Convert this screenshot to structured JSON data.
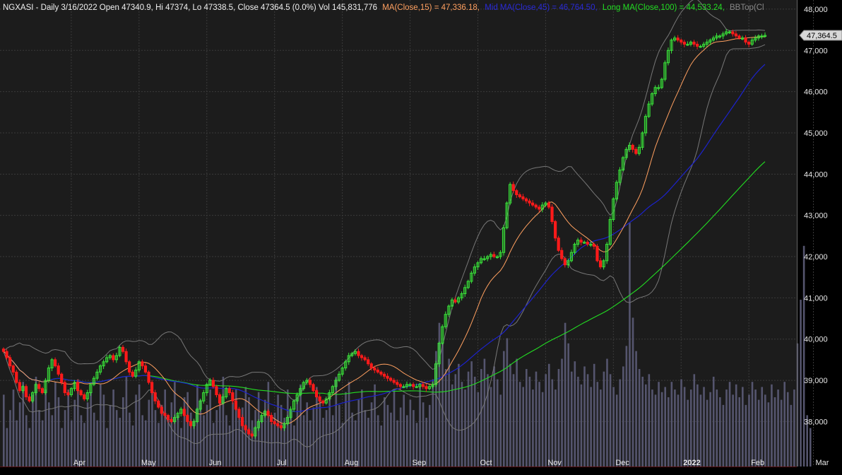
{
  "header": {
    "symbol_text": "NGXASI - Daily 3/16/2022 Open 47340.9, Hi 47374, Lo 47338.5, Close 47364.5 (0.0%) Vol 145,831,776",
    "ma15_text": "MA(Close,15) = 47,336.18,",
    "mid_ma_text": "Mid MA(Close,45) = 46,764.50,",
    "long_ma_text": "Long MA(Close,100) = 44,533.24,",
    "bb_text": "BBTop(Cl"
  },
  "price_label": "47,364.5",
  "colors": {
    "background": "#000000",
    "plot_bg": "#1c1c1c",
    "grid": "#3a3a3a",
    "up": "#39e639",
    "down": "#ff1a1a",
    "ma15": "#ffa060",
    "ma45": "#1c22cc",
    "ma100": "#22dd22",
    "bb": "#777777",
    "volume": "#55556e"
  },
  "chart_data": {
    "type": "candlestick",
    "title": "NGXASI - Daily",
    "ylim": [
      37400,
      48000
    ],
    "y_ticks": [
      38000,
      39000,
      40000,
      41000,
      42000,
      43000,
      44000,
      45000,
      46000,
      47000,
      48000
    ],
    "y_tick_labels": [
      "38,000",
      "39,000",
      "40,000",
      "41,000",
      "42,000",
      "43,000",
      "44,000",
      "45,000",
      "46,000",
      "47,000",
      "48,000"
    ],
    "x_tick_labels": [
      {
        "label": "Apr",
        "bar": 21
      },
      {
        "label": "May",
        "bar": 42
      },
      {
        "label": "Jun",
        "bar": 63
      },
      {
        "label": "Jul",
        "bar": 84
      },
      {
        "label": "Aug",
        "bar": 105
      },
      {
        "label": "Sep",
        "bar": 126
      },
      {
        "label": "Oct",
        "bar": 147
      },
      {
        "label": "Nov",
        "bar": 168
      },
      {
        "label": "Dec",
        "bar": 189
      },
      {
        "label": "2022",
        "bar": 210
      },
      {
        "label": "Feb",
        "bar": 231
      },
      {
        "label": "Mar",
        "bar": 251
      }
    ],
    "last_close": 47364.5,
    "closes": [
      39700,
      39550,
      39350,
      39200,
      38950,
      38750,
      38850,
      38600,
      38500,
      38700,
      38900,
      38800,
      38700,
      39000,
      39300,
      39500,
      39350,
      39150,
      38950,
      38700,
      38650,
      38800,
      38950,
      38750,
      38650,
      38550,
      38700,
      38900,
      39050,
      39200,
      39350,
      39450,
      39550,
      39600,
      39500,
      39600,
      39800,
      39700,
      39450,
      39200,
      39100,
      39250,
      39450,
      39350,
      39200,
      38950,
      38700,
      38500,
      38350,
      38200,
      38150,
      38050,
      38000,
      38100,
      38200,
      38300,
      38150,
      38000,
      37900,
      38000,
      38300,
      38500,
      38700,
      38900,
      39000,
      38850,
      38650,
      38450,
      38600,
      38800,
      38700,
      38500,
      38300,
      38100,
      37900,
      37800,
      37700,
      37650,
      37850,
      38000,
      38150,
      38250,
      38150,
      38000,
      37950,
      37900,
      37850,
      37950,
      38100,
      38300,
      38500,
      38650,
      38800,
      38950,
      39000,
      38900,
      38750,
      38600,
      38500,
      38450,
      38550,
      38700,
      38850,
      39000,
      39150,
      39300,
      39450,
      39600,
      39650,
      39700,
      39600,
      39550,
      39500,
      39400,
      39300,
      39250,
      39200,
      39150,
      39100,
      39050,
      39000,
      38950,
      38900,
      38850,
      38850,
      38900,
      38900,
      38850,
      38850,
      38900,
      38850,
      38800,
      38850,
      38900,
      39400,
      39900,
      40300,
      40600,
      40800,
      40950,
      40900,
      41000,
      41100,
      41250,
      41400,
      41600,
      41750,
      41850,
      41950,
      41950,
      42000,
      42050,
      42000,
      42000,
      42100,
      42700,
      43300,
      43750,
      43600,
      43500,
      43450,
      43400,
      43350,
      43300,
      43250,
      43200,
      43150,
      43250,
      43300,
      43200,
      42850,
      42450,
      42150,
      41950,
      41800,
      41900,
      42100,
      42300,
      42400,
      42350,
      42350,
      42300,
      42300,
      42250,
      41900,
      41750,
      41900,
      42300,
      42900,
      43400,
      43800,
      44100,
      44400,
      44600,
      44700,
      44600,
      44500,
      44650,
      45000,
      45400,
      45700,
      45950,
      46100,
      46100,
      46300,
      46700,
      47000,
      47250,
      47300,
      47250,
      47200,
      47150,
      47150,
      47200,
      47150,
      47100,
      47100,
      47150,
      47200,
      47250,
      47300,
      47350,
      47350,
      47400,
      47450,
      47450,
      47400,
      47350,
      47300,
      47300,
      47200,
      47150,
      47250,
      47300,
      47350,
      47350,
      47364.5
    ],
    "volume_ylim": [
      0,
      1
    ],
    "volume_rel": [
      0.28,
      0.15,
      0.22,
      0.3,
      0.18,
      0.25,
      0.33,
      0.2,
      0.15,
      0.28,
      0.35,
      0.22,
      0.18,
      0.3,
      0.25,
      0.2,
      0.33,
      0.27,
      0.15,
      0.22,
      0.3,
      0.18,
      0.26,
      0.34,
      0.2,
      0.17,
      0.25,
      0.29,
      0.21,
      0.18,
      0.32,
      0.28,
      0.15,
      0.24,
      0.3,
      0.22,
      0.19,
      0.27,
      0.35,
      0.21,
      0.16,
      0.28,
      0.32,
      0.2,
      0.18,
      0.26,
      0.31,
      0.22,
      0.17,
      0.24,
      0.3,
      0.19,
      0.25,
      0.33,
      0.2,
      0.15,
      0.27,
      0.29,
      0.21,
      0.18,
      0.32,
      0.26,
      0.2,
      0.24,
      0.3,
      0.17,
      0.22,
      0.28,
      0.35,
      0.2,
      0.16,
      0.25,
      0.3,
      0.19,
      0.23,
      0.31,
      0.27,
      0.18,
      0.22,
      0.29,
      0.2,
      0.26,
      0.33,
      0.17,
      0.21,
      0.28,
      0.24,
      0.19,
      0.3,
      0.22,
      0.16,
      0.27,
      0.32,
      0.2,
      0.25,
      0.18,
      0.23,
      0.31,
      0.26,
      0.19,
      0.22,
      0.28,
      0.2,
      0.35,
      0.24,
      0.17,
      0.29,
      0.33,
      0.21,
      0.18,
      0.26,
      0.3,
      0.22,
      0.19,
      0.25,
      0.32,
      0.2,
      0.16,
      0.27,
      0.24,
      0.21,
      0.3,
      0.18,
      0.23,
      0.28,
      0.2,
      0.26,
      0.22,
      0.17,
      0.31,
      0.25,
      0.19,
      0.24,
      0.34,
      0.45,
      0.56,
      0.48,
      0.38,
      0.42,
      0.32,
      0.36,
      0.4,
      0.33,
      0.3,
      0.37,
      0.41,
      0.35,
      0.29,
      0.38,
      0.42,
      0.36,
      0.31,
      0.39,
      0.34,
      0.28,
      0.45,
      0.5,
      0.4,
      0.36,
      0.42,
      0.33,
      0.31,
      0.38,
      0.35,
      0.3,
      0.37,
      0.33,
      0.29,
      0.36,
      0.4,
      0.34,
      0.3,
      0.38,
      0.42,
      0.56,
      0.48,
      0.37,
      0.41,
      0.35,
      0.32,
      0.39,
      0.36,
      0.31,
      0.4,
      0.33,
      0.3,
      0.37,
      0.42,
      0.36,
      0.31,
      0.28,
      0.34,
      0.39,
      0.47,
      0.95,
      0.58,
      0.45,
      0.38,
      0.35,
      0.32,
      0.36,
      0.3,
      0.28,
      0.33,
      0.29,
      0.31,
      0.27,
      0.33,
      0.3,
      0.28,
      0.34,
      0.31,
      0.26,
      0.3,
      0.36,
      0.32,
      0.28,
      0.31,
      0.26,
      0.29,
      0.35,
      0.3,
      0.27,
      0.24,
      0.3,
      0.33,
      0.28,
      0.32,
      0.27,
      0.31,
      0.24,
      0.28,
      0.33,
      0.3,
      0.26,
      0.31,
      0.28,
      0.25,
      0.32,
      0.27,
      0.3,
      0.26,
      0.33,
      0.29,
      0.24,
      0.3,
      0.48,
      0.65,
      0.86,
      0.2,
      0.15
    ]
  }
}
